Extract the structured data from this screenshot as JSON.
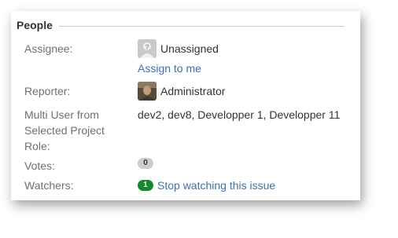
{
  "section": {
    "title": "People"
  },
  "assignee": {
    "label": "Assignee:",
    "value": "Unassigned",
    "avatar_icon": "unassigned-user-icon",
    "assign_link": "Assign to me"
  },
  "reporter": {
    "label": "Reporter:",
    "value": "Administrator",
    "avatar_icon": "user-avatar"
  },
  "multi_user": {
    "label_lines": [
      "Multi User from",
      "Selected Project",
      "Role:"
    ],
    "value": "dev2, dev8, Developper 1, Developper 11"
  },
  "votes": {
    "label": "Votes:",
    "count": "0"
  },
  "watchers": {
    "label": "Watchers:",
    "count": "1",
    "link": "Stop watching this issue"
  },
  "colors": {
    "link": "#3b73af",
    "label": "#707070",
    "badge_grey": "#cccccc",
    "badge_green": "#14892c"
  }
}
